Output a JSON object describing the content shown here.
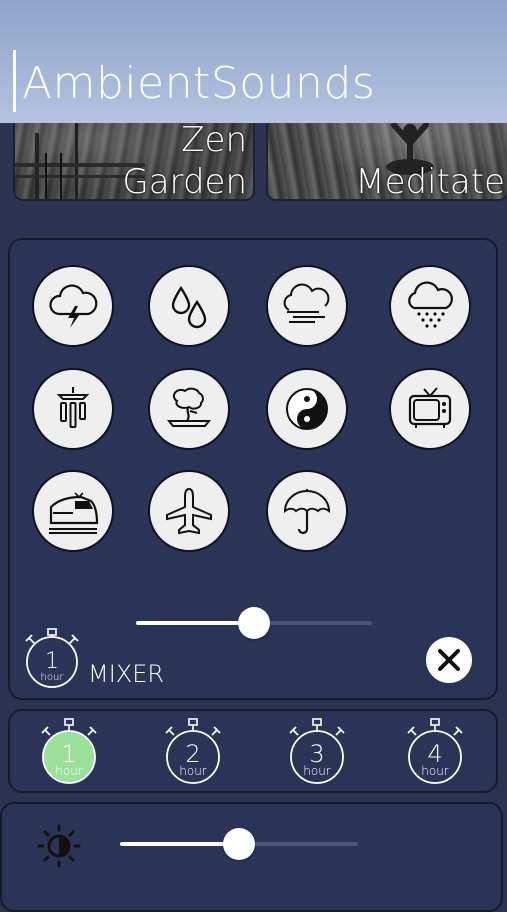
{
  "app": {
    "title": "AmbientSounds"
  },
  "scenes": [
    {
      "label_line1": "Zen",
      "label_line2": "Garden"
    },
    {
      "label_line1": "Meditate"
    }
  ],
  "sounds": [
    {
      "name": "Thunderstorm",
      "icon": "thunderstorm-icon"
    },
    {
      "name": "Rain drops",
      "icon": "raindrops-icon"
    },
    {
      "name": "Wind",
      "icon": "wind-icon"
    },
    {
      "name": "Rain",
      "icon": "rain-cloud-icon"
    },
    {
      "name": "Wind chimes",
      "icon": "wind-chimes-icon"
    },
    {
      "name": "Bonsai",
      "icon": "bonsai-icon"
    },
    {
      "name": "Yin yang",
      "icon": "yin-yang-icon"
    },
    {
      "name": "TV static",
      "icon": "tv-icon"
    },
    {
      "name": "Train",
      "icon": "train-icon"
    },
    {
      "name": "Airplane",
      "icon": "airplane-icon"
    },
    {
      "name": "Umbrella",
      "icon": "umbrella-icon"
    }
  ],
  "mixer": {
    "label": "MIXER",
    "volume_fraction": 0.5,
    "timer": {
      "number": "1",
      "unit": "hour"
    },
    "close_icon": "close-icon"
  },
  "timers": [
    {
      "number": "1",
      "unit": "hour",
      "selected": true
    },
    {
      "number": "2",
      "unit": "hour",
      "selected": false
    },
    {
      "number": "3",
      "unit": "hour",
      "selected": false
    },
    {
      "number": "4",
      "unit": "hour",
      "selected": false
    }
  ],
  "brightness": {
    "icon": "brightness-icon",
    "level_fraction": 0.5
  },
  "colors": {
    "background": "#2b3350",
    "panel": "#2a3457",
    "header": "#a2b5d6",
    "selected_timer": "#9be09b",
    "button_face": "#efefef"
  }
}
